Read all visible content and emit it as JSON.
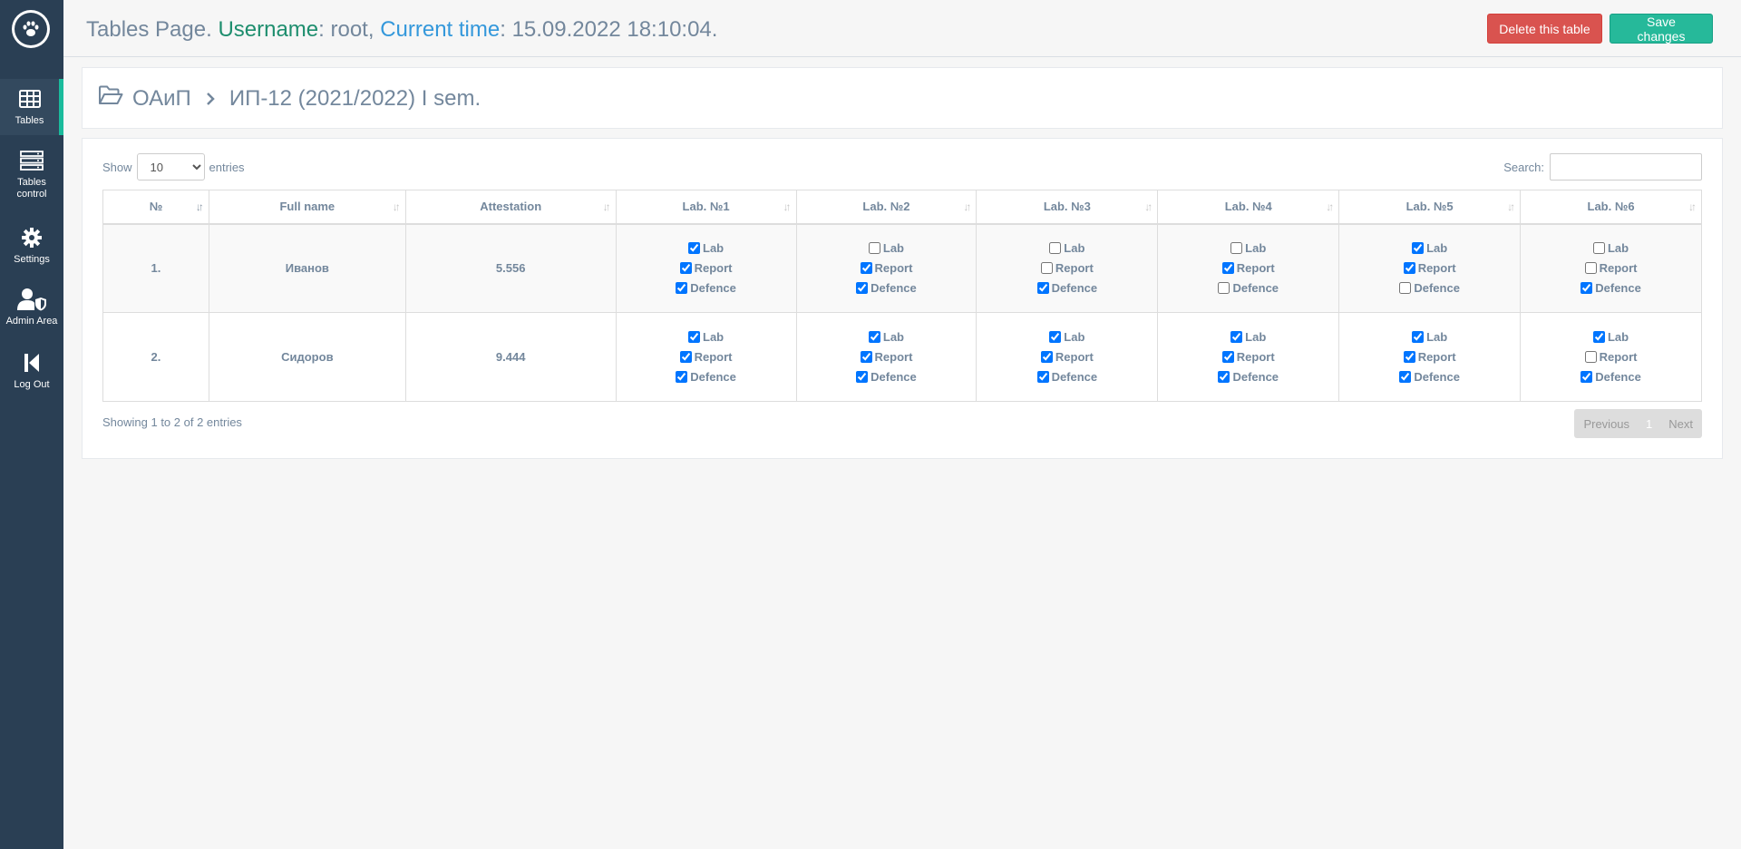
{
  "sidebar": {
    "items": [
      {
        "label": "Tables",
        "icon": "table-icon"
      },
      {
        "label": "Tables control",
        "icon": "server-icon"
      },
      {
        "label": "Settings",
        "icon": "gear-icon"
      },
      {
        "label": "Admin Area",
        "icon": "user-shield-icon"
      },
      {
        "label": "Log Out",
        "icon": "step-backward-icon"
      }
    ]
  },
  "header": {
    "title_prefix": "Tables Page.",
    "username_label": "Username",
    "username_value": ": root,",
    "time_label": "Current time",
    "time_value": ": 15.09.2022 18:10:04.",
    "delete_label": "Delete this table",
    "save_label": "Save changes"
  },
  "breadcrumb": {
    "subject": "ОАиП",
    "group": "ИП-12 (2021/2022) I sem."
  },
  "table_controls": {
    "show_label": "Show",
    "entries_value": "10",
    "entries_label": "entries",
    "search_label": "Search:",
    "search_value": ""
  },
  "table": {
    "columns": [
      "№",
      "Full name",
      "Attestation",
      "Lab. №1",
      "Lab. №2",
      "Lab. №3",
      "Lab. №4",
      "Lab. №5",
      "Lab. №6"
    ],
    "check_labels": [
      "Lab",
      "Report",
      "Defence"
    ],
    "rows": [
      {
        "num": "1.",
        "name": "Иванов",
        "attestation": "5.556",
        "labs": [
          [
            true,
            true,
            true
          ],
          [
            false,
            true,
            true
          ],
          [
            false,
            false,
            true
          ],
          [
            false,
            true,
            false
          ],
          [
            true,
            true,
            false
          ],
          [
            false,
            false,
            true
          ]
        ]
      },
      {
        "num": "2.",
        "name": "Сидоров",
        "attestation": "9.444",
        "labs": [
          [
            true,
            true,
            true
          ],
          [
            true,
            true,
            true
          ],
          [
            true,
            true,
            true
          ],
          [
            true,
            true,
            true
          ],
          [
            true,
            true,
            true
          ],
          [
            true,
            false,
            true
          ]
        ]
      }
    ]
  },
  "footer": {
    "info": "Showing 1 to 2 of 2 entries",
    "prev": "Previous",
    "page": "1",
    "next": "Next"
  }
}
